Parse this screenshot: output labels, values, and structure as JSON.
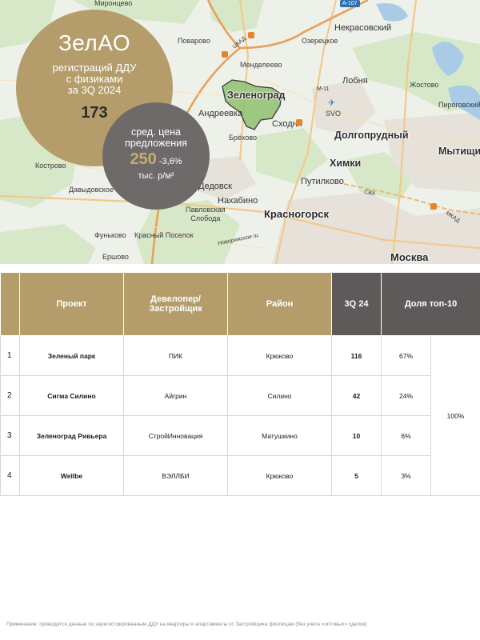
{
  "map": {
    "places": {
      "mironcevo": "Миронцево",
      "nekrasovsky": "Некрасовский",
      "ozeretskoe": "Озерецкое",
      "povarovo": "Поварово",
      "mendeleevo": "Менделеево",
      "lobnya": "Лобня",
      "zhostovo": "Жостово",
      "zelenograd": "Зеленоград",
      "andreevka": "Андреевка",
      "skhodnya": "Сходня",
      "svo": "SVO",
      "pirogovsky": "Пироговский",
      "dolgoprudny": "Долгопрудный",
      "mytishchi": "Мытищи",
      "brekhovo": "Брёхово",
      "khimki": "Химки",
      "kostrovo": "Кострово",
      "putilkovo": "Путилково",
      "davydovskoe": "Давыдовское",
      "dedovsk": "Дедовск",
      "nakhabino": "Нахабино",
      "pavlovskaya": "Павловская\nСлобода",
      "krasnogorsk": "Красногорск",
      "funkovo": "Фуньково",
      "krasny": "Красный Поселок",
      "ershovo": "Ершово",
      "moskva": "Москва",
      "novorizhskoe": "Новорижское ш.",
      "tsklad": "ЦКАД",
      "svkh": "СВХ",
      "mkad": "МКАД",
      "m11": "М-11",
      "a107": "А-107"
    }
  },
  "gold_circle": {
    "title": "ЗелАО",
    "subtitle_lines": [
      "регистраций ДДУ",
      "с физиками",
      "за 3Q 2024"
    ],
    "value": "173"
  },
  "grey_circle": {
    "subtitle_lines": [
      "сред. цена",
      "предложения"
    ],
    "price": "250",
    "change": "-3,6%",
    "unit": "тыс. р/м²"
  },
  "table": {
    "headers": {
      "project": "Проект",
      "developer": "Девелопер/ Застройщик",
      "district": "Район",
      "period": "3Q 24",
      "share": "Доля топ-10"
    },
    "rows": [
      {
        "n": "1",
        "project": "Зеленый парк",
        "developer": "ПИК",
        "district": "Крюково",
        "value": "116",
        "share": "67%"
      },
      {
        "n": "2",
        "project": "Сигма Силино",
        "developer": "Айгрин",
        "district": "Силино",
        "value": "42",
        "share": "24%"
      },
      {
        "n": "3",
        "project": "Зеленоград Ривьера",
        "developer": "СтройИнновация",
        "district": "Матушкино",
        "value": "10",
        "share": "6%"
      },
      {
        "n": "4",
        "project": "Wellbe",
        "developer": "ВЭЛЛБИ",
        "district": "Крюково",
        "value": "5",
        "share": "3%"
      }
    ],
    "total_share": "100%"
  },
  "note": "Примечание: приводятся данные по зарегистрированным ДДУ на квартиры и апартаменты от Застройщика физлицам (без учета «оптовых» сделок)",
  "colors": {
    "gold": "#b59d6b",
    "grey": "#5e5a5a",
    "zelao_region": "#8fbf6e",
    "map_bg": "#eef1ea"
  }
}
